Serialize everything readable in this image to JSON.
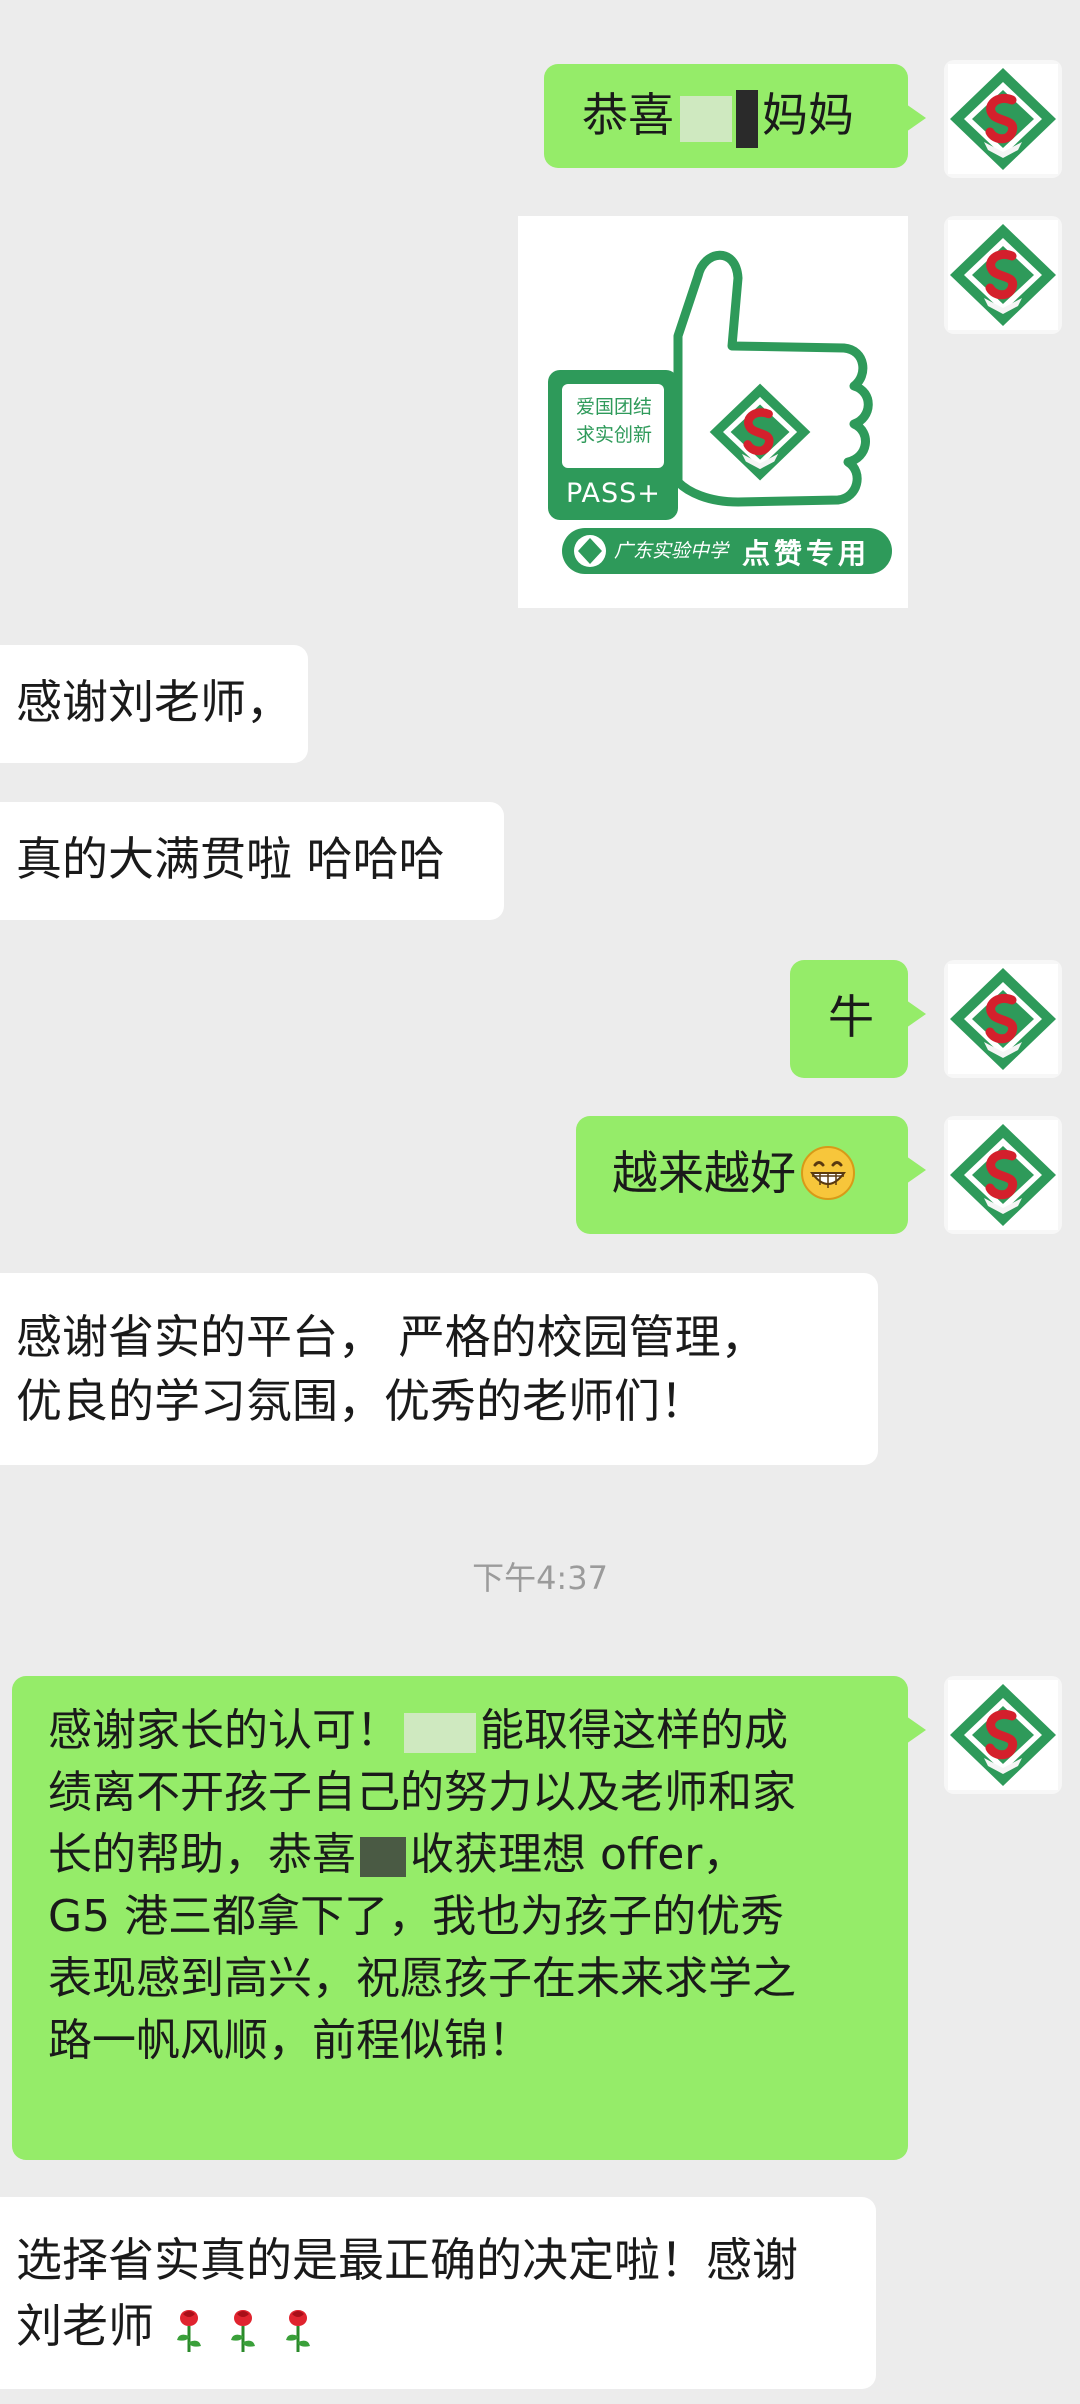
{
  "chat": {
    "messages": [
      {
        "side": "right",
        "text": "恭喜"
      },
      {
        "side": "right",
        "text_suffix": "妈妈"
      },
      {
        "side": "right",
        "sticker": {
          "badge_lines": [
            "爱国团结",
            "求实创新"
          ],
          "pass_label": "PASS+",
          "footer_label": "点赞专用",
          "footer_school": "广东实验中学"
        }
      },
      {
        "side": "left",
        "text": "感谢刘老师，"
      },
      {
        "side": "left",
        "text": "真的大满贯啦 哈哈哈"
      },
      {
        "side": "right",
        "text": "牛"
      },
      {
        "side": "right",
        "text": "越来越好"
      },
      {
        "side": "left",
        "lines": [
          "感谢省实的平台， 严格的校园管理，",
          "优良的学习氛围，优秀的老师们！"
        ]
      },
      {
        "side": "right",
        "lines": [
          "感谢家长的认可！",
          "能取得这样的成",
          "绩离不开孩子自己的努力以及老师和家",
          "长的帮助，恭喜",
          "收获理想 offer，",
          "G5 港三都拿下了，我也为孩子的优秀",
          "表现感到高兴，祝愿孩子在未来求学之",
          "路一帆风顺，前程似锦！"
        ]
      },
      {
        "side": "left",
        "lines": [
          "选择省实真的是最正确的决定啦！感谢",
          "刘老师"
        ]
      }
    ],
    "timestamp": "下午4:37"
  },
  "colors": {
    "me_bubble": "#95ec69",
    "them_bubble": "#ffffff",
    "background": "#ececec",
    "avatar_red": "#d4202c",
    "avatar_green": "#2e9a5a"
  },
  "icons": {
    "grin": "grinning-face-emoji",
    "rose": "rose-emoji"
  }
}
